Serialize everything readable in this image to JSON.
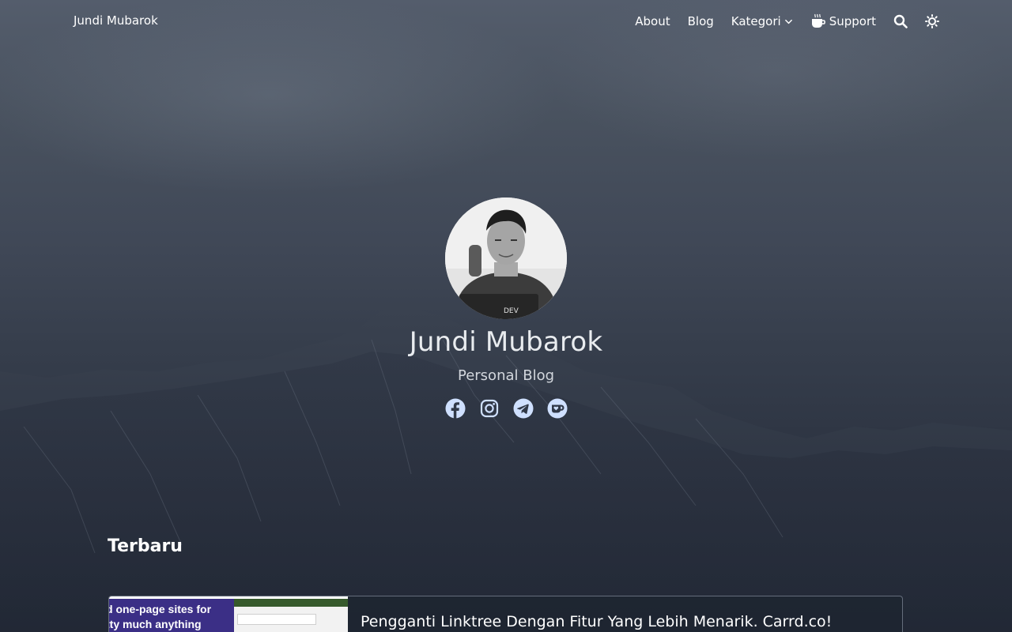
{
  "nav": {
    "brand": "Jundi Mubarok",
    "links": [
      "About",
      "Blog",
      "Kategori",
      "Support"
    ],
    "icons": {
      "kategori_chevron": "chevron-down-icon",
      "support": "coffee-icon",
      "search": "search-icon",
      "theme": "sun-icon"
    }
  },
  "hero": {
    "name": "Jundi Mubarok",
    "subtitle": "Personal Blog",
    "socials": [
      "facebook-icon",
      "instagram-icon",
      "telegram-icon",
      "kofi-icon"
    ]
  },
  "latest": {
    "title": "Terbaru",
    "posts": [
      {
        "title": "Pengganti Linktree Dengan Fitur Yang Lebih Menarik. Carrd.co!",
        "thumbnail_text": [
          "d one-page sites for",
          "tty much anything"
        ]
      }
    ]
  },
  "colors": {
    "nav_text": "#ffffff",
    "hero_name": "#e9ecef",
    "social_icon": "#cfe0ff",
    "card_border": "#a0aab9"
  }
}
